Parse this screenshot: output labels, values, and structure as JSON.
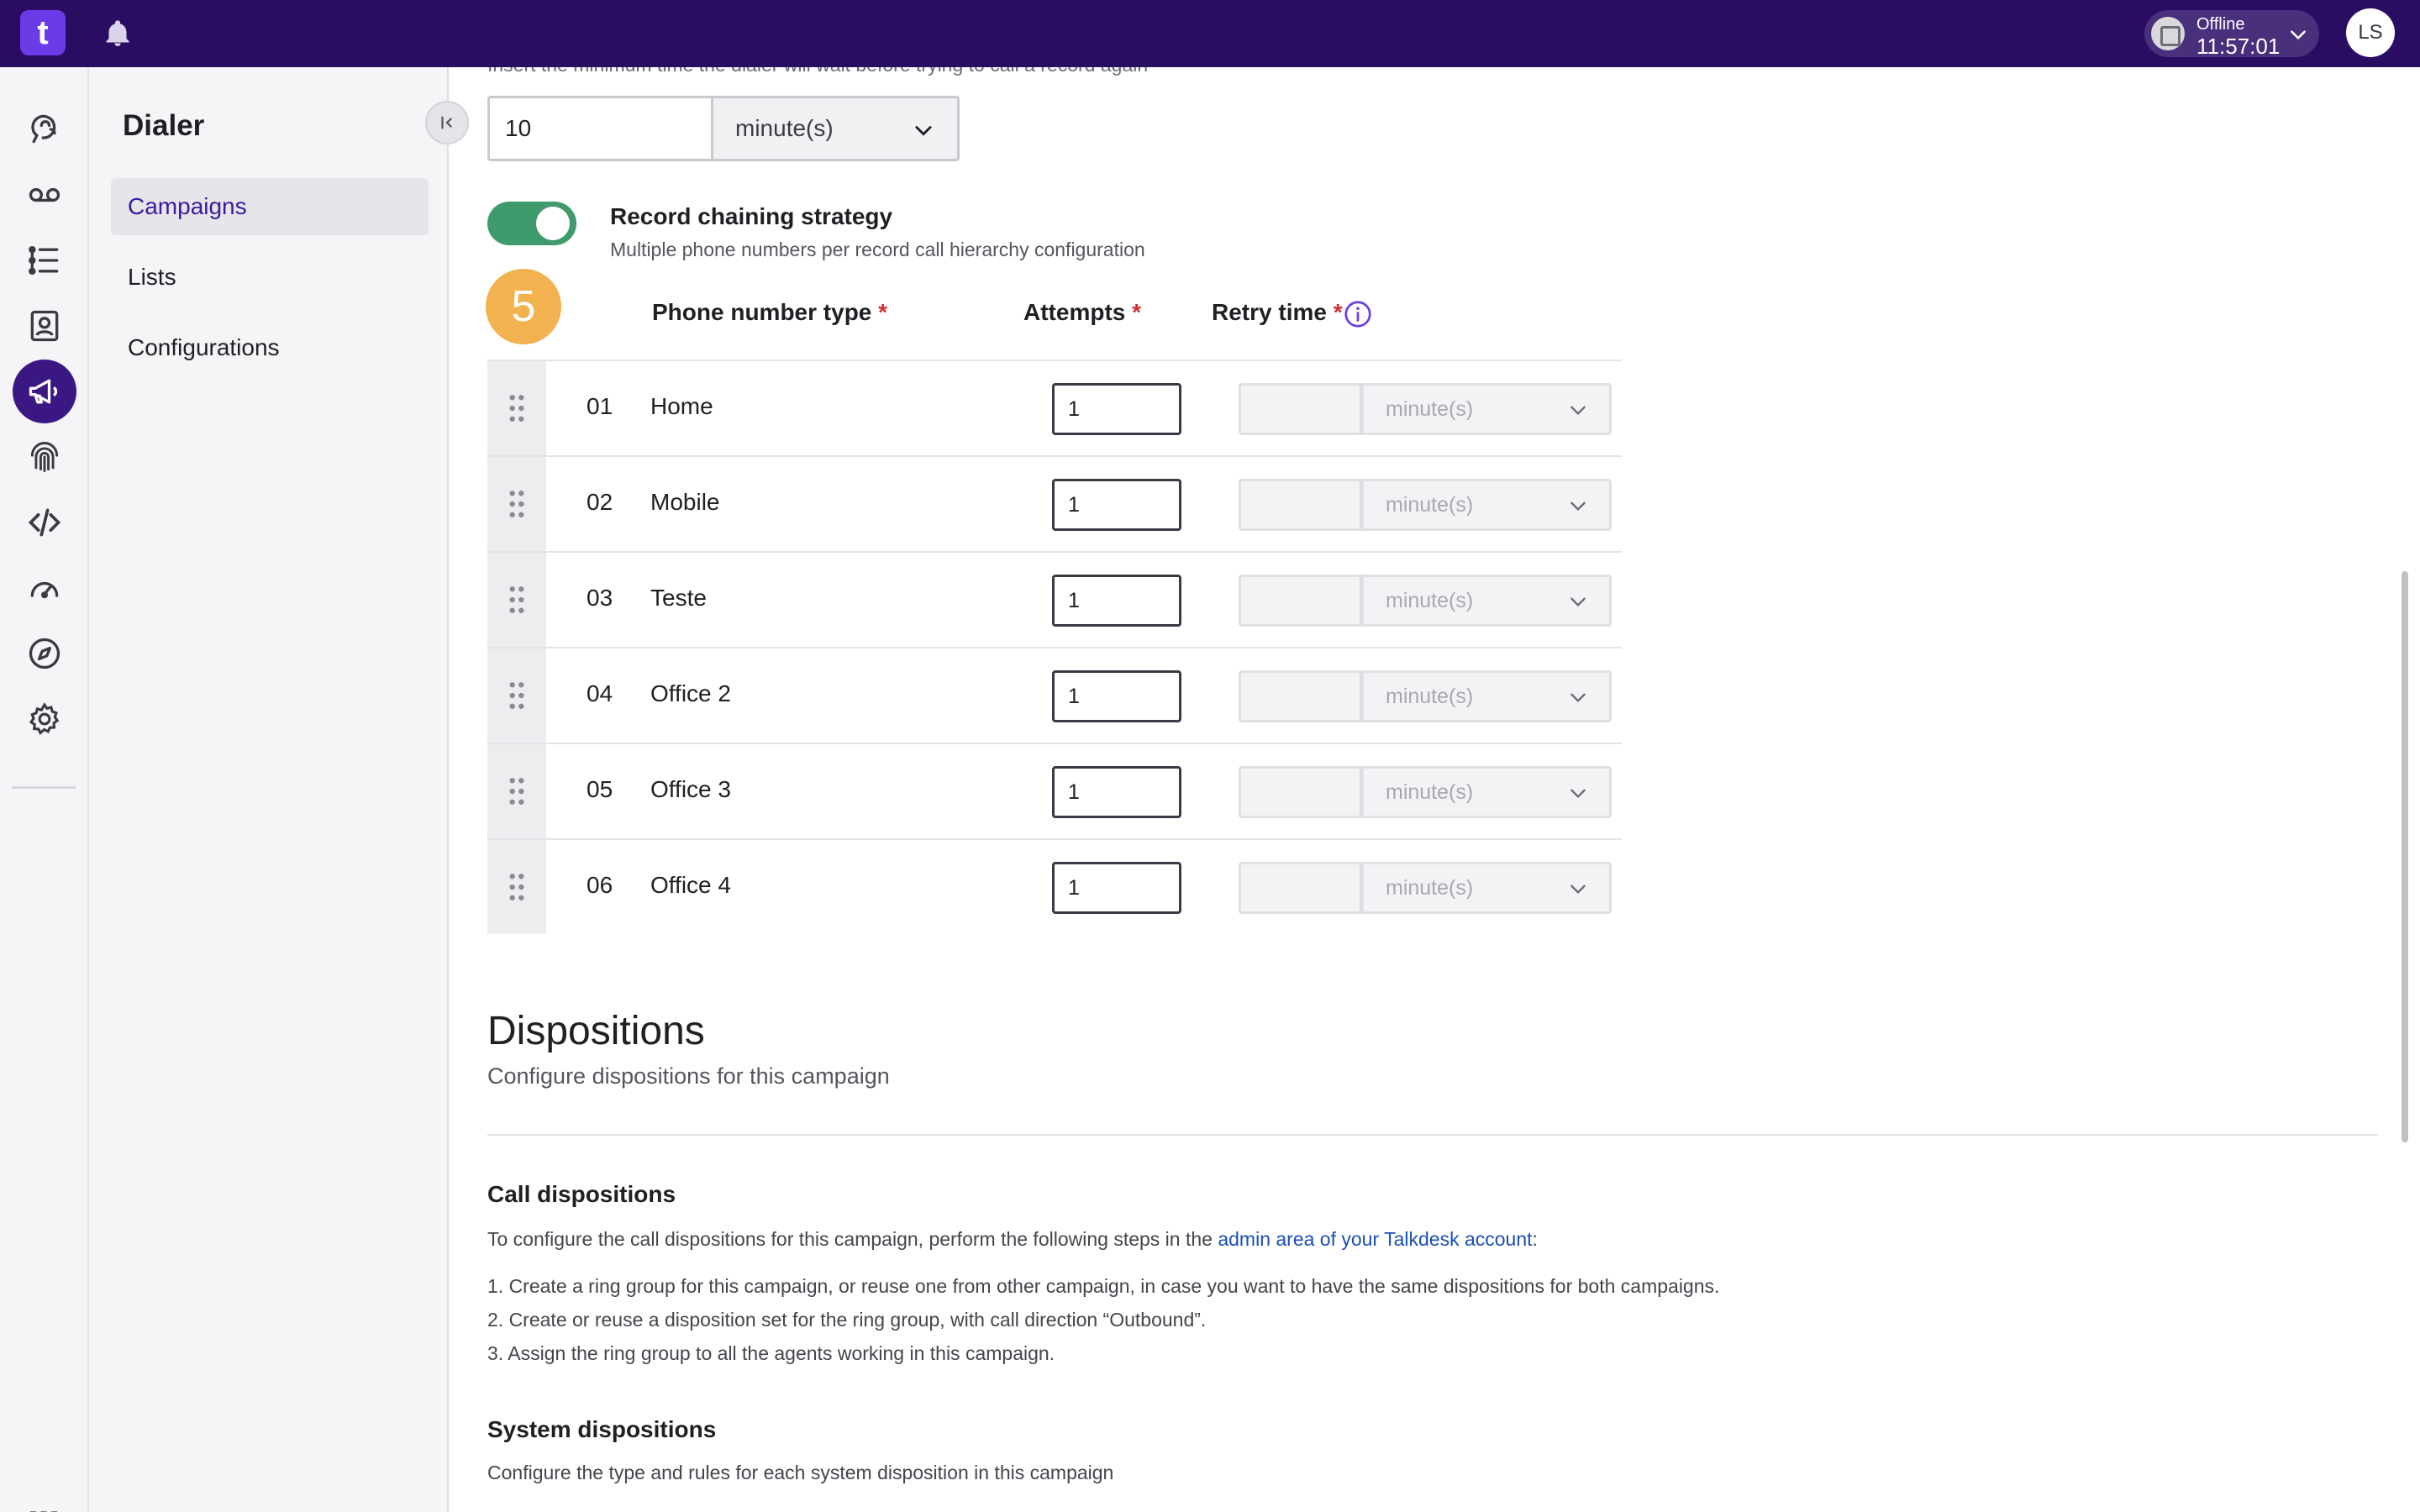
{
  "topbar": {
    "logo_letter": "t",
    "status": {
      "label": "Offline",
      "time": "11:57:01"
    },
    "avatar_initials": "LS"
  },
  "rail": {
    "icons": [
      "conversations-icon",
      "voicemail-icon",
      "list-icon",
      "contacts-icon",
      "megaphone-icon",
      "fingerprint-icon",
      "code-icon",
      "gauge-icon",
      "compass-icon",
      "gear-icon"
    ],
    "active": "megaphone-icon"
  },
  "sidenav": {
    "title": "Dialer",
    "items": [
      {
        "label": "Campaigns",
        "active": true
      },
      {
        "label": "Lists",
        "active": false
      },
      {
        "label": "Configurations",
        "active": false
      }
    ]
  },
  "retry_min": {
    "helper": "Insert the minimum time the dialer will wait before trying to call a record again",
    "value": "10",
    "unit": "minute(s)"
  },
  "chaining": {
    "enabled": true,
    "title": "Record chaining strategy",
    "subtitle": "Multiple phone numbers per record call hierarchy configuration",
    "step": "5",
    "columns": {
      "type": "Phone number type",
      "attempts": "Attempts",
      "retry": "Retry time",
      "required_mark": "*"
    },
    "rows": [
      {
        "num": "01",
        "type": "Home",
        "attempts": "1",
        "retry_unit": "minute(s)"
      },
      {
        "num": "02",
        "type": "Mobile",
        "attempts": "1",
        "retry_unit": "minute(s)"
      },
      {
        "num": "03",
        "type": "Teste",
        "attempts": "1",
        "retry_unit": "minute(s)"
      },
      {
        "num": "04",
        "type": "Office 2",
        "attempts": "1",
        "retry_unit": "minute(s)"
      },
      {
        "num": "05",
        "type": "Office 3",
        "attempts": "1",
        "retry_unit": "minute(s)"
      },
      {
        "num": "06",
        "type": "Office 4",
        "attempts": "1",
        "retry_unit": "minute(s)"
      }
    ]
  },
  "dispositions": {
    "title": "Dispositions",
    "subtitle": "Configure dispositions for this campaign",
    "call": {
      "title": "Call dispositions",
      "intro_before": "To configure the call dispositions for this campaign, perform the following steps in the ",
      "intro_link": "admin area of your Talkdesk account",
      "intro_after": ":",
      "steps": [
        "1. Create a ring group for this campaign, or reuse one from other campaign, in case you want to have the same dispositions for both campaigns.",
        "2. Create or reuse a disposition set for the ring group, with call direction “Outbound”.",
        "3. Assign the ring group to all the agents working in this campaign."
      ]
    },
    "system": {
      "title": "System dispositions",
      "subtitle": "Configure the type and rules for each system disposition in this campaign"
    }
  },
  "colors": {
    "topbar": "#2a0d62",
    "accent": "#3b1784",
    "toggle_on": "#3f9a6c",
    "step_badge": "#f1b24f",
    "required": "#d32f2f",
    "link": "#1a4fb8"
  }
}
